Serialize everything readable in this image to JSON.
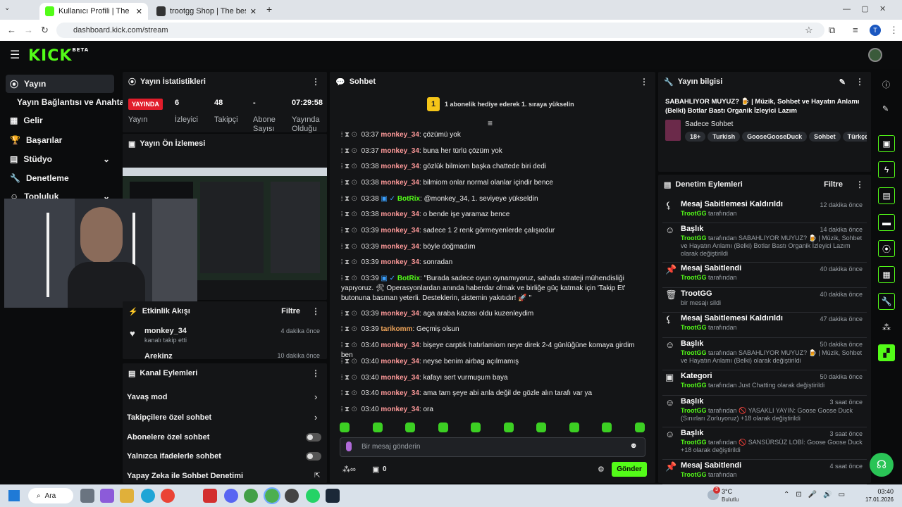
{
  "browser": {
    "tabs": [
      {
        "title": "Kullanıcı Profili | The best Track"
      },
      {
        "title": "trootgg Shop | The best ChatB..."
      }
    ],
    "url": "dashboard.kick.com/stream",
    "profile_initial": "T"
  },
  "sidebar": {
    "items": [
      {
        "label": "Yayın"
      },
      {
        "label": "Yayın Bağlantısı ve Anahtarı"
      },
      {
        "label": "Gelir"
      },
      {
        "label": "Başarılar"
      },
      {
        "label": "Stüdyo"
      },
      {
        "label": "Denetleme"
      },
      {
        "label": "Topluluk"
      }
    ]
  },
  "stats": {
    "title": "Yayın İstatistikleri",
    "live": "YAYINDA",
    "live_sub": "Yayın",
    "items": [
      {
        "value": "6",
        "label": "İzleyici"
      },
      {
        "value": "48",
        "label": "Takipçi"
      },
      {
        "value": "-",
        "label": "Abone Sayısı"
      },
      {
        "value": "07:29:58",
        "label": "Yayında Olduğu"
      }
    ]
  },
  "preview": {
    "title": "Yayın Ön İzlemesi"
  },
  "activity": {
    "title": "Etkinlik Akışı",
    "filter": "Filtre",
    "items": [
      {
        "name": "monkey_34",
        "sub": "kanalı takip etti",
        "ago": "4 dakika önce"
      },
      {
        "name": "Arekinz",
        "sub": "",
        "ago": "10 dakika önce"
      }
    ]
  },
  "channel": {
    "title": "Kanal Eylemleri",
    "items": [
      {
        "label": "Yavaş mod"
      },
      {
        "label": "Takipçilere özel sohbet"
      },
      {
        "label": "Abonelere özel sohbet"
      },
      {
        "label": "Yalnızca ifadelerle sohbet"
      },
      {
        "label": "Yapay Zeka ile Sohbet Denetimi"
      }
    ]
  },
  "chat": {
    "title": "Sohbet",
    "banner": "1 abonelik hediye ederek 1. sıraya yükselin",
    "banner_num": "1",
    "placeholder": "Bir mesaj gönderin",
    "send": "Gönder",
    "count": "0",
    "messages": [
      {
        "time": "03:37",
        "user": "monkey_34",
        "text": "çözümü yok"
      },
      {
        "time": "03:37",
        "user": "monkey_34",
        "text": "buna her türlü çözüm yok"
      },
      {
        "time": "03:38",
        "user": "monkey_34",
        "text": "gözlük bilmiom başka chattede biri dedi"
      },
      {
        "time": "03:38",
        "user": "monkey_34",
        "text": "bilmiom onlar normal olanlar içindir bence"
      },
      {
        "time": "03:38",
        "user": "BotRix",
        "text": "@monkey_34, 1. seviyeye yükseldin"
      },
      {
        "time": "03:38",
        "user": "monkey_34",
        "text": "o bende işe yaramaz bence"
      },
      {
        "time": "03:39",
        "user": "monkey_34",
        "text": "sadece 1 2 renk görmeyenlerde çalışıodur"
      },
      {
        "time": "03:39",
        "user": "monkey_34",
        "text": "böyle doğmadım"
      },
      {
        "time": "03:39",
        "user": "monkey_34",
        "text": "sonradan"
      },
      {
        "time": "03:39",
        "user": "BotRix",
        "text": "\"Burada sadece oyun oynamıyoruz, sahada strateji mühendisliği yapıyoruz. 🛠 Operasyonlardan anında haberdar olmak ve birliğe güç katmak için 'Takip Et' butonuna basman yeterli. Desteklerin, sistemin yakıtıdır! 🚀 \""
      },
      {
        "time": "03:39",
        "user": "monkey_34",
        "text": "aga araba kazası oldu kuzenleydim"
      },
      {
        "time": "03:39",
        "user": "tarikomm",
        "text": "Geçmiş olsun"
      },
      {
        "time": "03:40",
        "user": "monkey_34",
        "text": "bişeye carptık hatırlamiom neye direk 2-4 günlüğüne komaya girdim ben"
      },
      {
        "time": "03:40",
        "user": "monkey_34",
        "text": "neyse benim airbag açılmamış"
      },
      {
        "time": "03:40",
        "user": "monkey_34",
        "text": "kafayı sert vurmuşum baya"
      },
      {
        "time": "03:40",
        "user": "monkey_34",
        "text": "ama tam şeye abi anla değil de gözle alın tarafı var ya"
      },
      {
        "time": "03:40",
        "user": "monkey_34",
        "text": "ora"
      }
    ]
  },
  "info": {
    "title": "Yayın bilgisi",
    "stream_title": "SABAHLIYOR MUYUZ? 🍺 | Müzik, Sohbet ve Hayatın Anlamı (Belki) Botlar Bastı Organik İzleyici Lazım",
    "category": "Sadece Sohbet",
    "tags": [
      "18+",
      "Turkish",
      "GooseGooseDuck",
      "Sohbet",
      "Türkçe"
    ]
  },
  "moderation": {
    "title": "Denetim Eylemleri",
    "filter": "Filtre",
    "items": [
      {
        "title": "Mesaj Sabitlemesi Kaldırıldı",
        "actor": "TrootGG",
        "desc": "tarafından",
        "ago": "12 dakika önce"
      },
      {
        "title": "Başlık",
        "actor": "TrootGG",
        "desc": "tarafından SABAHLIYOR MUYUZ? 🍺 | Müzik, Sohbet ve Hayatın Anlamı (Belki) Botlar Bastı Organik İzleyici Lazım olarak değiştirildi",
        "ago": "14 dakika önce"
      },
      {
        "title": "Mesaj Sabitlendi",
        "actor": "TrootGG",
        "desc": "tarafından",
        "ago": "40 dakika önce"
      },
      {
        "title": "TrootGG",
        "actor": "",
        "desc": "bir mesajı sildi",
        "ago": "40 dakika önce"
      },
      {
        "title": "Mesaj Sabitlemesi Kaldırıldı",
        "actor": "TrootGG",
        "desc": "tarafından",
        "ago": "47 dakika önce"
      },
      {
        "title": "Başlık",
        "actor": "TrootGG",
        "desc": "tarafından SABAHLIYOR MUYUZ? 🍺 | Müzik, Sohbet ve Hayatın Anlamı (Belki) olarak değiştirildi",
        "ago": "50 dakika önce"
      },
      {
        "title": "Kategori",
        "actor": "TrootGG",
        "desc": "tarafından Just Chatting olarak değiştirildi",
        "ago": "50 dakika önce"
      },
      {
        "title": "Başlık",
        "actor": "TrootGG",
        "desc": "tarafından 🚫 YASAKLI YAYIN: Goose Goose Duck (Sınırları Zorluyoruz) +18 olarak değiştirildi",
        "ago": "3 saat önce"
      },
      {
        "title": "Başlık",
        "actor": "TrootGG",
        "desc": "tarafından 🚫 SANSÜRSÜZ LOBİ: Goose Goose Duck +18 olarak değiştirildi",
        "ago": "3 saat önce"
      },
      {
        "title": "Mesaj Sabitlendi",
        "actor": "TrootGG",
        "desc": "tarafından",
        "ago": "4 saat önce"
      }
    ]
  },
  "taskbar": {
    "search": "Ara",
    "weather": "3°C",
    "weather_sub": "Bulutlu",
    "time": "03:40",
    "date": "17.01.2026",
    "badge": "3"
  }
}
